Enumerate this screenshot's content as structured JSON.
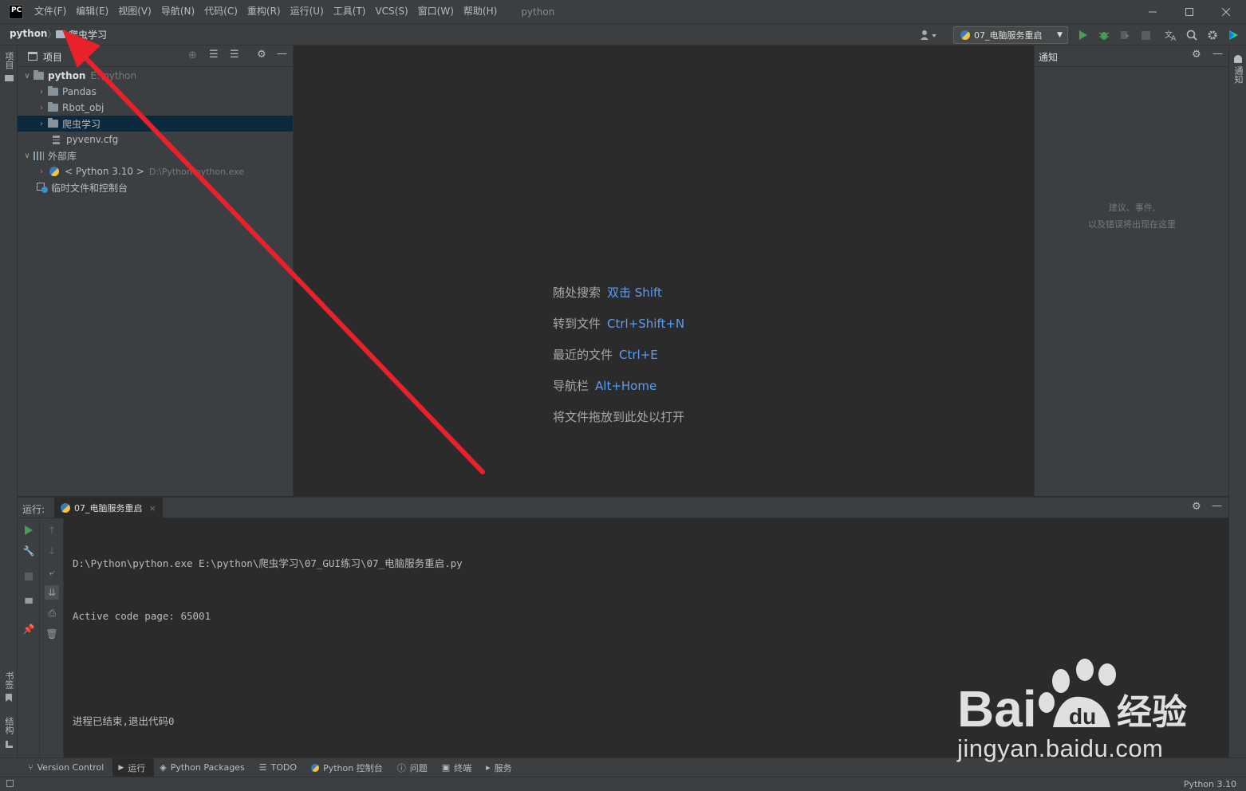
{
  "app": {
    "logo": "PC",
    "window_title": "python",
    "menu": [
      "文件(F)",
      "编辑(E)",
      "视图(V)",
      "导航(N)",
      "代码(C)",
      "重构(R)",
      "运行(U)",
      "工具(T)",
      "VCS(S)",
      "窗口(W)",
      "帮助(H)"
    ]
  },
  "navbar": {
    "breadcrumb_root": "python",
    "breadcrumb_child": "爬虫学习",
    "run_config": "07_电脑服务重启"
  },
  "left_stripe": {
    "project_tab": "项目",
    "bookmarks_tab": "书签",
    "structure_tab": "结构"
  },
  "right_stripe": {
    "notifications_tab": "通知"
  },
  "project": {
    "title": "项目",
    "tree": [
      {
        "label": "python",
        "hint": "E:\\python",
        "type": "root"
      },
      {
        "label": "Pandas",
        "type": "folder"
      },
      {
        "label": "Rbot_obj",
        "type": "folder"
      },
      {
        "label": "爬虫学习",
        "type": "folder",
        "selected": true
      },
      {
        "label": "pyvenv.cfg",
        "type": "file"
      },
      {
        "label": "外部库",
        "type": "library"
      },
      {
        "label": "< Python 3.10 >",
        "hint": "D:\\Python\\python.exe",
        "type": "sdk"
      },
      {
        "label": "临时文件和控制台",
        "type": "scratch"
      }
    ]
  },
  "editor": {
    "tips": [
      {
        "label": "随处搜索",
        "shortcut": "双击 Shift"
      },
      {
        "label": "转到文件",
        "shortcut": "Ctrl+Shift+N"
      },
      {
        "label": "最近的文件",
        "shortcut": "Ctrl+E"
      },
      {
        "label": "导航栏",
        "shortcut": "Alt+Home"
      },
      {
        "label": "将文件拖放到此处以打开",
        "shortcut": ""
      }
    ]
  },
  "notifications": {
    "title": "通知",
    "empty_line1": "建议、事件,",
    "empty_line2": "以及错误将出现在这里"
  },
  "run": {
    "label": "运行:",
    "tab": "07_电脑服务重启",
    "console": [
      "D:\\Python\\python.exe E:\\python\\爬虫学习\\07_GUI练习\\07_电脑服务重启.py",
      "Active code page: 65001",
      "",
      "进程已结束,退出代码0"
    ]
  },
  "bottom_tools": [
    {
      "label": "Version Control",
      "icon": "branch-icon"
    },
    {
      "label": "运行",
      "icon": "play-icon",
      "active": true
    },
    {
      "label": "Python Packages",
      "icon": "layers-icon"
    },
    {
      "label": "TODO",
      "icon": "list-icon"
    },
    {
      "label": "Python 控制台",
      "icon": "python-icon"
    },
    {
      "label": "问题",
      "icon": "info-icon"
    },
    {
      "label": "终端",
      "icon": "terminal-icon"
    },
    {
      "label": "服务",
      "icon": "services-icon"
    }
  ],
  "status": {
    "interpreter": "Python 3.10"
  },
  "watermark": {
    "brand": "Bai",
    "brand_suffix": "经验",
    "url": "jingyan.baidu.com"
  },
  "colors": {
    "accent_blue": "#589df6",
    "annotation_red": "#e8212a",
    "panel_bg": "#3c3f41",
    "editor_bg": "#2b2b2b",
    "selection": "#0d293e"
  }
}
